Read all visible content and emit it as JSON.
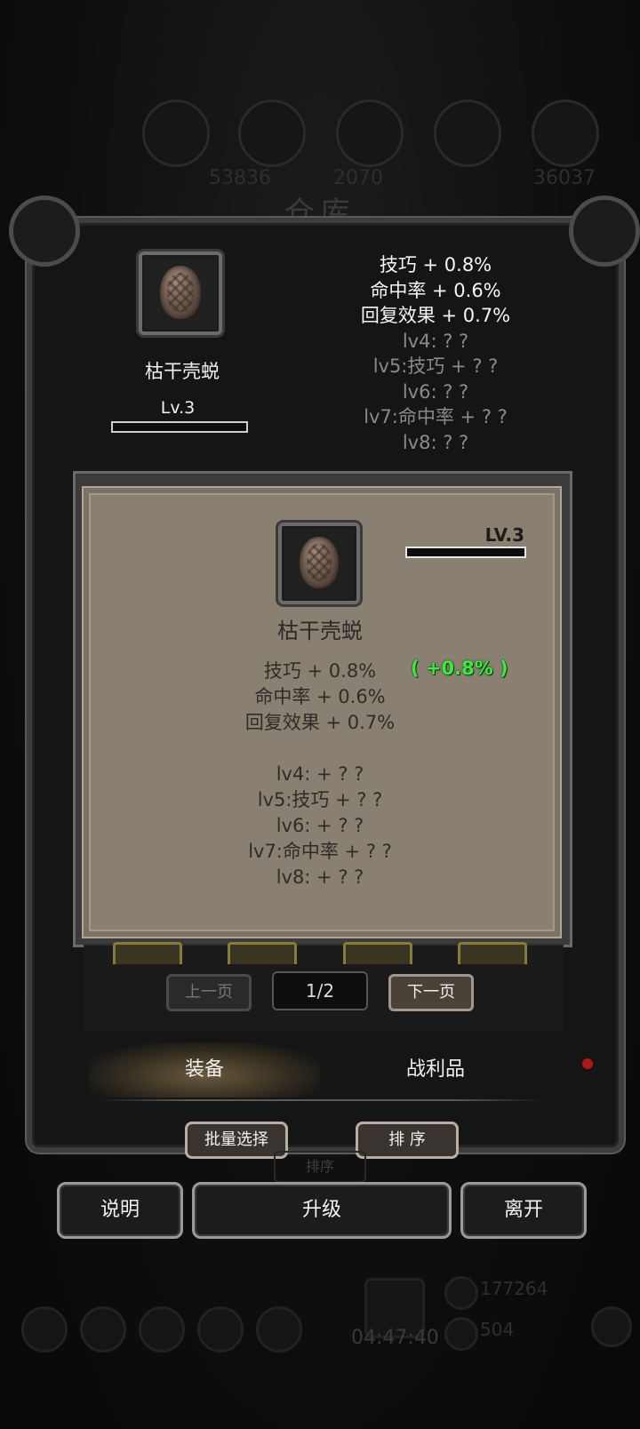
{
  "window": {
    "title": "仓库"
  },
  "background": {
    "resource_counts": [
      "53836",
      "2070",
      "36037"
    ],
    "currency_gold": "177264",
    "currency_gem": "504",
    "timer": "04:47:40"
  },
  "item_summary": {
    "name": "枯干壳蜕",
    "level": "Lv.3",
    "level_progress": 0.0,
    "icon": "dried-shell-icon",
    "stats": [
      {
        "text": "技巧 + 0.8%",
        "unlocked": true
      },
      {
        "text": "命中率 + 0.6%",
        "unlocked": true
      },
      {
        "text": "回复效果 + 0.7%",
        "unlocked": true
      },
      {
        "text": "lv4: ? ?",
        "unlocked": false
      },
      {
        "text": "lv5:技巧 + ? ?",
        "unlocked": false
      },
      {
        "text": "lv6: ? ?",
        "unlocked": false
      },
      {
        "text": "lv7:命中率 + ? ?",
        "unlocked": false
      },
      {
        "text": "lv8: ? ?",
        "unlocked": false
      }
    ]
  },
  "detail_panel": {
    "name": "枯干壳蜕",
    "level": "LV.3",
    "level_progress": 0.0,
    "icon": "dried-shell-icon",
    "bonus": "( +0.8% )",
    "stats": [
      "技巧 + 0.8%",
      "命中率 + 0.6%",
      "回复效果 + 0.7%"
    ],
    "locked_stats": [
      "lv4: + ? ?",
      "lv5:技巧 + ? ?",
      "lv6: + ? ?",
      "lv7:命中率 + ? ?",
      "lv8: + ? ?"
    ]
  },
  "pagination": {
    "prev_label": "上一页",
    "next_label": "下一页",
    "indicator": "1/2"
  },
  "tabs": [
    {
      "label": "装备",
      "active": true
    },
    {
      "label": "战利品",
      "active": false
    }
  ],
  "actions": {
    "batch_select": "批量选择",
    "sort": "排 序",
    "sort_background": "排序"
  },
  "footer": {
    "explain": "说明",
    "upgrade": "升级",
    "leave": "离开"
  },
  "colors": {
    "bonus_green": "#3ee83e",
    "panel_bg": "#8a8071"
  }
}
